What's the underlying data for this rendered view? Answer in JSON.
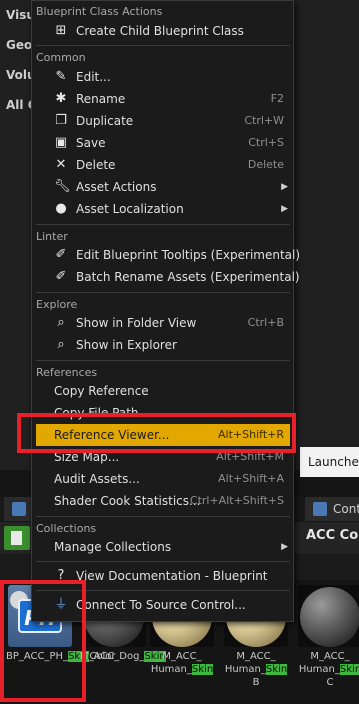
{
  "colors": {
    "accent_highlight": "#e3a800",
    "red_annotation": "#e8202a",
    "skin_highlight": "#3eb83e"
  },
  "background": {
    "left_labels": [
      "Visua",
      "Geon",
      "Volun",
      "All Cl"
    ],
    "launches_text": "Launches",
    "tabs": [
      "C",
      "Cont"
    ],
    "acc_title": "ACC Co",
    "assets": [
      {
        "pre": "BP_ACC_PH_",
        "hl": "Skin",
        "post": "Color",
        "icon": "physics-asset-icon"
      },
      {
        "pre": "M_ACC_Dog_",
        "hl": "Skin",
        "post": "",
        "icon": "material-sphere-icon"
      },
      {
        "pre": "M_ACC_ Human_",
        "hl": "Skin",
        "post": "",
        "icon": "material-sphere-icon"
      },
      {
        "pre": "M_ACC_ Human_",
        "hl": "Skin",
        "post": " B",
        "icon": "material-sphere-icon"
      },
      {
        "pre": "M_ACC_ Human_",
        "hl": "Skin",
        "post": " C",
        "icon": "material-sphere-icon"
      }
    ],
    "thumb_ph_text": "PH"
  },
  "menu": {
    "sections": {
      "blueprint": "Blueprint Class Actions",
      "common": "Common",
      "linter": "Linter",
      "explore": "Explore",
      "references": "References",
      "collections": "Collections"
    },
    "items": {
      "create_child": {
        "label": "Create Child Blueprint Class",
        "icon": "blueprint-child-icon"
      },
      "edit": {
        "label": "Edit...",
        "icon": "edit-icon"
      },
      "rename": {
        "label": "Rename",
        "shortcut": "F2",
        "icon": "rename-icon"
      },
      "duplicate": {
        "label": "Duplicate",
        "shortcut": "Ctrl+W",
        "icon": "duplicate-icon"
      },
      "save": {
        "label": "Save",
        "shortcut": "Ctrl+S",
        "icon": "save-icon"
      },
      "delete": {
        "label": "Delete",
        "shortcut": "Delete",
        "icon": "delete-icon"
      },
      "asset_actions": {
        "label": "Asset Actions",
        "icon": "wrench-icon"
      },
      "asset_localization": {
        "label": "Asset Localization",
        "icon": "globe-icon"
      },
      "edit_tooltips": {
        "label": "Edit Blueprint Tooltips (Experimental)",
        "icon": "edit-tooltips-icon"
      },
      "batch_rename": {
        "label": "Batch Rename Assets (Experimental)",
        "icon": "batch-rename-icon"
      },
      "show_folder": {
        "label": "Show in Folder View",
        "shortcut": "Ctrl+B",
        "icon": "folder-search-icon"
      },
      "show_explorer": {
        "label": "Show in Explorer",
        "icon": "explorer-icon"
      },
      "copy_reference": {
        "label": "Copy Reference"
      },
      "copy_file_path": {
        "label": "Copy File Path"
      },
      "reference_viewer": {
        "label": "Reference Viewer...",
        "shortcut": "Alt+Shift+R"
      },
      "size_map": {
        "label": "Size Map...",
        "shortcut": "Alt+Shift+M"
      },
      "audit_assets": {
        "label": "Audit Assets...",
        "shortcut": "Alt+Shift+A"
      },
      "shader_cook": {
        "label": "Shader Cook Statistics...",
        "shortcut": "Ctrl+Alt+Shift+S"
      },
      "manage_collections": {
        "label": "Manage Collections"
      },
      "view_docs": {
        "label": "View Documentation - Blueprint",
        "icon": "help-icon"
      },
      "connect_source": {
        "label": "Connect To Source Control...",
        "icon": "source-control-icon"
      }
    }
  }
}
